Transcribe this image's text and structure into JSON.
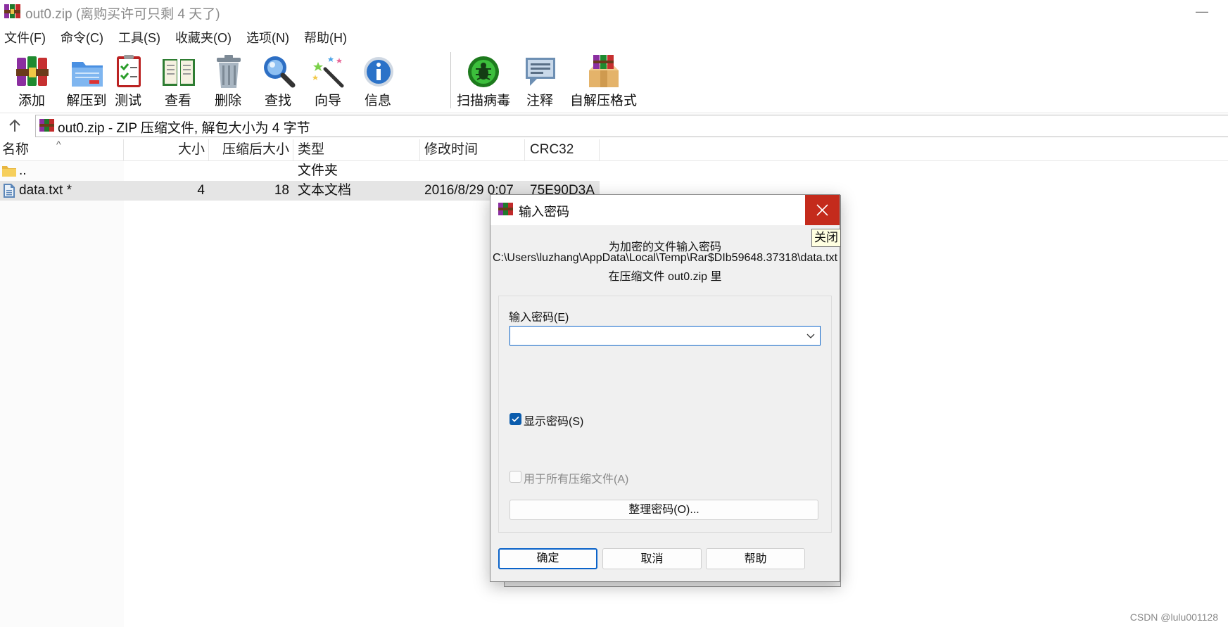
{
  "window": {
    "title": "out0.zip (离购买许可只剩 4 天了)",
    "minimize_glyph": "—",
    "app_icon": "winrar-icon"
  },
  "menu": [
    "文件(F)",
    "命令(C)",
    "工具(S)",
    "收藏夹(O)",
    "选项(N)",
    "帮助(H)"
  ],
  "toolbar": [
    {
      "label": "添加",
      "icon": "add-archive-icon"
    },
    {
      "label": "解压到",
      "icon": "extract-to-icon"
    },
    {
      "label": "测试",
      "icon": "test-icon"
    },
    {
      "label": "查看",
      "icon": "view-book-icon"
    },
    {
      "label": "删除",
      "icon": "trash-icon"
    },
    {
      "label": "查找",
      "icon": "magnifier-icon"
    },
    {
      "label": "向导",
      "icon": "wizard-wand-icon"
    },
    {
      "label": "信息",
      "icon": "info-icon"
    },
    {
      "label": "扫描病毒",
      "icon": "virus-scan-icon"
    },
    {
      "label": "注释",
      "icon": "comment-icon"
    },
    {
      "label": "自解压格式",
      "icon": "sfx-box-icon"
    }
  ],
  "address": {
    "text": "out0.zip - ZIP 压缩文件, 解包大小为 4 字节",
    "up_glyph": "🡡"
  },
  "columns": {
    "name": "名称",
    "size": "大小",
    "packed": "压缩后大小",
    "type": "类型",
    "modified": "修改时间",
    "crc": "CRC32",
    "sort_glyph": "^"
  },
  "rows": [
    {
      "name": "..",
      "size": "",
      "packed": "",
      "type": "文件夹",
      "modified": "",
      "crc": ""
    },
    {
      "name": "data.txt *",
      "size": "4",
      "packed": "18",
      "type": "文本文档",
      "modified": "2016/8/29 0:07",
      "crc": "75E90D3A"
    }
  ],
  "dialog": {
    "title": "输入密码",
    "close_tooltip": "关闭",
    "message_line1": "为加密的文件输入密码",
    "message_line2": "C:\\Users\\luzhang\\AppData\\Local\\Temp\\Rar$DIb59648.37318\\data.txt",
    "message_line3": "在压缩文件 out0.zip 里",
    "password_label": "输入密码(E)",
    "password_value": "",
    "show_password_label": "显示密码(S)",
    "show_password_checked": true,
    "use_all_label": "用于所有压缩文件(A)",
    "use_all_checked": false,
    "manage_button": "整理密码(O)...",
    "ok_button": "确定",
    "cancel_button": "取消",
    "help_button": "帮助"
  },
  "watermark": "CSDN @lulu001128",
  "colors": {
    "close_red": "#c42b1c",
    "accent_blue": "#0b63c9",
    "selected_row": "#e5e5e5",
    "dialog_bg": "#f0f0f0"
  }
}
